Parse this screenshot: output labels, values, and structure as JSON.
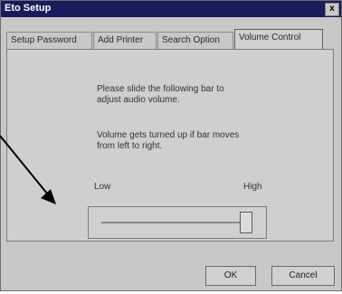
{
  "window": {
    "title": "Eto Setup",
    "close_glyph": "x"
  },
  "tabs": [
    {
      "label": "Setup Password"
    },
    {
      "label": "Add Printer"
    },
    {
      "label": "Search Option"
    },
    {
      "label": "Volume Control"
    }
  ],
  "content": {
    "instruction": "Please slide the following bar to adjust audio volume.",
    "note": "Volume gets turned up if bar moves from left to right.",
    "low_label": "Low",
    "high_label": "High"
  },
  "volume_slider": {
    "value": 0.95
  },
  "buttons": {
    "ok": "OK",
    "cancel": "Cancel"
  },
  "annotation": {
    "arrow_color": "#000000"
  }
}
